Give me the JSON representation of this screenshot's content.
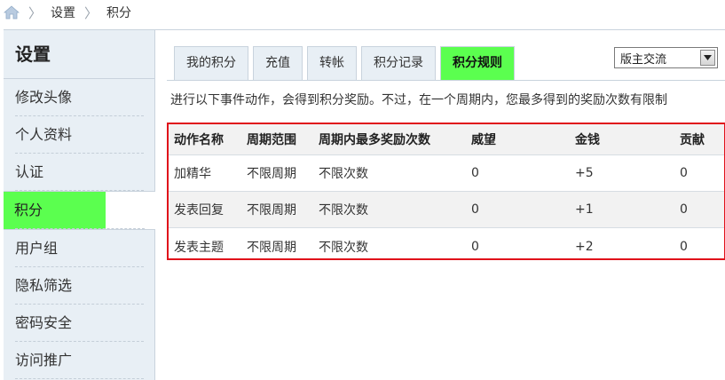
{
  "breadcrumb": {
    "items": [
      "设置",
      "积分"
    ]
  },
  "sidebar": {
    "title": "设置",
    "items": [
      {
        "label": "修改头像",
        "active": false
      },
      {
        "label": "个人资料",
        "active": false
      },
      {
        "label": "认证",
        "active": false
      },
      {
        "label": "积分",
        "active": true
      },
      {
        "label": "用户组",
        "active": false
      },
      {
        "label": "隐私筛选",
        "active": false
      },
      {
        "label": "密码安全",
        "active": false
      },
      {
        "label": "访问推广",
        "active": false
      }
    ]
  },
  "tabs": [
    {
      "label": "我的积分",
      "active": false
    },
    {
      "label": "充值",
      "active": false
    },
    {
      "label": "转帐",
      "active": false
    },
    {
      "label": "积分记录",
      "active": false
    },
    {
      "label": "积分规则",
      "active": true
    }
  ],
  "forum_select": {
    "value": "版主交流"
  },
  "notice": "进行以下事件动作，会得到积分奖励。不过，在一个周期内，您最多得到的奖励次数有限制",
  "rules_table": {
    "columns": [
      "动作名称",
      "周期范围",
      "周期内最多奖励次数",
      "威望",
      "金钱",
      "贡献"
    ],
    "rows": [
      [
        "加精华",
        "不限周期",
        "不限次数",
        "0",
        "+5",
        "0"
      ],
      [
        "发表回复",
        "不限周期",
        "不限次数",
        "0",
        "+1",
        "0"
      ],
      [
        "发表主题",
        "不限周期",
        "不限次数",
        "0",
        "+2",
        "0"
      ]
    ]
  },
  "colors": {
    "active_green": "#5bff4f",
    "highlight_border": "#e0121b",
    "sidebar_bg": "#e8eff5"
  }
}
